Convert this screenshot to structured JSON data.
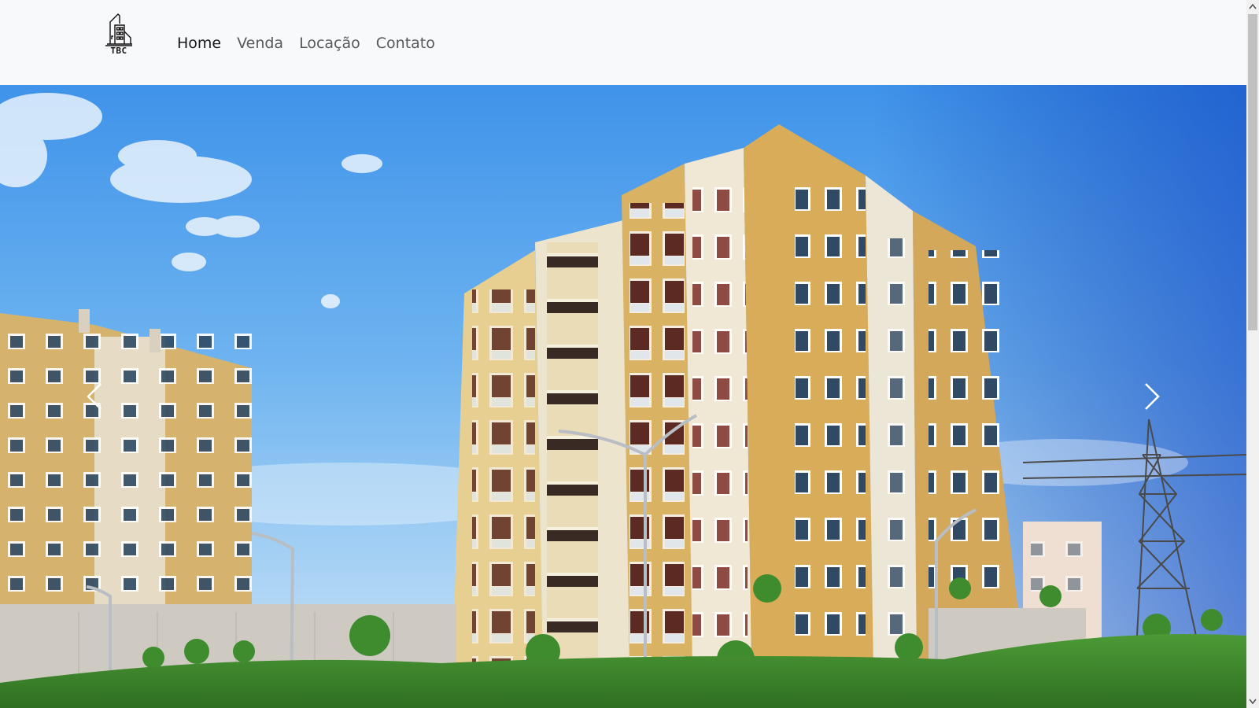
{
  "navbar": {
    "brand": {
      "logo_icon": "building-icon",
      "text": "TBC"
    },
    "links": [
      {
        "label": "Home",
        "active": true
      },
      {
        "label": "Venda",
        "active": false
      },
      {
        "label": "Locação",
        "active": false
      },
      {
        "label": "Contato",
        "active": false
      }
    ]
  },
  "carousel": {
    "slide_image": "apartment-buildings-photo",
    "prev_icon": "chevron-left-icon",
    "next_icon": "chevron-right-icon"
  },
  "scrollbar": {
    "up_icon": "caret-up-icon",
    "down_icon": "caret-down-icon"
  },
  "colors": {
    "navbar_bg": "#f8f9fa",
    "sky_top": "#4a9ef0",
    "building_yellow": "#d9b263",
    "building_cream": "#efe5cc",
    "grass": "#3f8a2e"
  }
}
